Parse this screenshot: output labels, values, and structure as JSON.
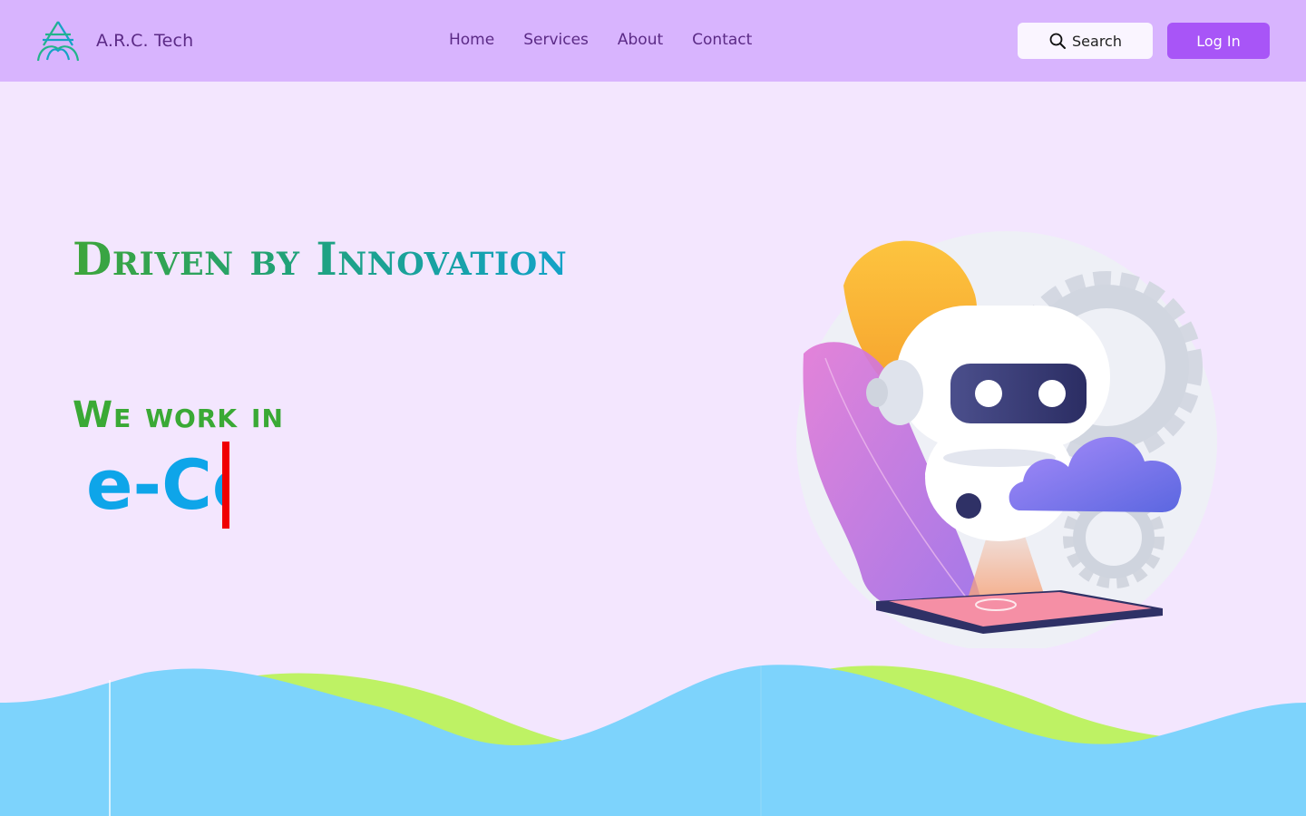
{
  "header": {
    "brand_name": "A.R.C. Tech",
    "logo_icon": "arc-tech-logo-icon",
    "nav": [
      {
        "label": "Home"
      },
      {
        "label": "Services"
      },
      {
        "label": "About"
      },
      {
        "label": "Contact"
      }
    ],
    "search_label": "Search",
    "search_icon": "search-icon",
    "login_label": "Log In"
  },
  "hero": {
    "title": "Driven by Innovation",
    "subtitle": "We work in",
    "typed_text": "e-Co",
    "illustration": "robot-with-gears-cloud-tablet-illustration"
  },
  "colors": {
    "header_bg": "#d8b4fe",
    "page_bg": "#f3e6fe",
    "brand_text": "#5b2a86",
    "login_button": "#a855f7",
    "title_gradient_start": "#3da53a",
    "title_gradient_end": "#12a2c8",
    "subtitle": "#3aa935",
    "typed_text": "#0ea5e9",
    "cursor": "#f00000",
    "wave_blue": "#7dd3fc",
    "wave_green": "#bef264"
  }
}
